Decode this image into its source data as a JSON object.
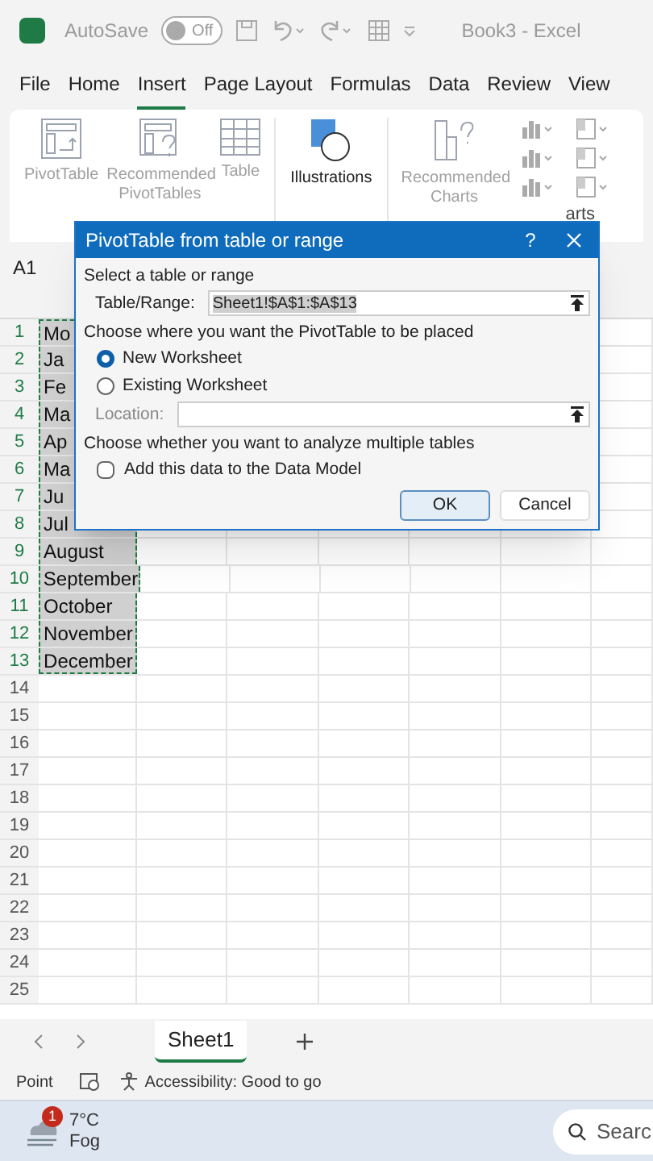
{
  "title_bar": {
    "autosave_label": "AutoSave",
    "autosave": {
      "on": false,
      "label": "Off"
    },
    "title": "Book3  -  Excel"
  },
  "tabs": [
    {
      "label": "File",
      "selected": false
    },
    {
      "label": "Home",
      "selected": false
    },
    {
      "label": "Insert",
      "selected": true
    },
    {
      "label": "Page Layout",
      "selected": false
    },
    {
      "label": "Formulas",
      "selected": false
    },
    {
      "label": "Data",
      "selected": false
    },
    {
      "label": "Review",
      "selected": false
    },
    {
      "label": "View",
      "selected": false
    }
  ],
  "ribbon": {
    "groups": [
      {
        "kind": "pivot",
        "label": "PivotTable",
        "disabled": true
      },
      {
        "kind": "recpivot",
        "label": "Recommended PivotTables",
        "disabled": true
      },
      {
        "kind": "table",
        "label": "Table",
        "disabled": true
      },
      {
        "kind": "illustrations",
        "label": "Illustrations",
        "disabled": false
      },
      {
        "kind": "charts",
        "label": "Recommended Charts",
        "disabled": true
      }
    ],
    "charts_group_label": "arts"
  },
  "name_box": "A1",
  "rows": [
    {
      "number": "1",
      "cell": "Mo"
    },
    {
      "number": "2",
      "cell": "Ja"
    },
    {
      "number": "3",
      "cell": "Fe"
    },
    {
      "number": "4",
      "cell": "Ma"
    },
    {
      "number": "5",
      "cell": "Ap"
    },
    {
      "number": "6",
      "cell": "Ma"
    },
    {
      "number": "7",
      "cell": "Ju"
    },
    {
      "number": "8",
      "cell": "Jul"
    },
    {
      "number": "9",
      "cell": "August"
    },
    {
      "number": "10",
      "cell": "September"
    },
    {
      "number": "11",
      "cell": "October"
    },
    {
      "number": "12",
      "cell": "November"
    },
    {
      "number": "13",
      "cell": "December"
    },
    {
      "number": "14"
    },
    {
      "number": "15"
    },
    {
      "number": "16"
    },
    {
      "number": "17"
    },
    {
      "number": "18"
    },
    {
      "number": "19"
    },
    {
      "number": "20"
    },
    {
      "number": "21"
    },
    {
      "number": "22"
    },
    {
      "number": "23"
    },
    {
      "number": "24"
    },
    {
      "number": "25"
    }
  ],
  "dialog": {
    "title": "PivotTable from table or range",
    "help": "?",
    "section_1": "Select a table or range",
    "range_label": "Table/Range:",
    "range_value": "Sheet1!$A$1:$A$13",
    "section_2": "Choose where you want the PivotTable to be placed",
    "options": [
      {
        "label": "New Worksheet",
        "selected": true
      },
      {
        "label": "Existing Worksheet",
        "selected": false
      }
    ],
    "location_label": "Location:",
    "section_3": "Choose whether you want to analyze multiple tables",
    "data_model": {
      "label": "Add this data to the Data Model",
      "checked": false
    },
    "buttons": [
      {
        "label": "OK",
        "focused": true
      },
      {
        "label": "Cancel",
        "focused": false
      }
    ]
  },
  "sheet_tabs": [
    {
      "label": "Sheet1",
      "selected": true
    }
  ],
  "status_bar": {
    "mode": "Point",
    "accessibility": "Accessibility: Good to go"
  },
  "taskbar": {
    "weather_badge": "1",
    "temperature": "7°C",
    "condition": "Fog",
    "search": "Searc"
  }
}
